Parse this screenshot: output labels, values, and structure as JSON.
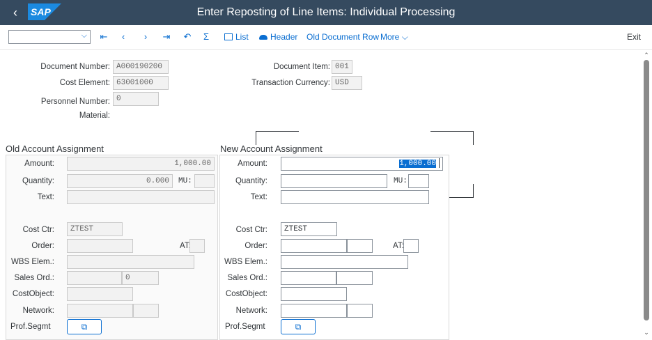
{
  "shell": {
    "back_glyph": "‹",
    "logo_text": "SAP",
    "title": "Enter Reposting of Line Items: Individual Processing"
  },
  "toolbar": {
    "select_value": "",
    "first_glyph": "⇤",
    "prev_glyph": "‹",
    "next_glyph": "›",
    "last_glyph": "⇥",
    "undo_glyph": "↶",
    "sum_glyph": "Σ",
    "list_label": "List",
    "header_label": "Header",
    "old_doc_row_label": "Old Document Row",
    "more_label": "More",
    "exit_label": "Exit"
  },
  "header": {
    "doc_number_label": "Document Number:",
    "doc_number_value": "A000190200",
    "cost_element_label": "Cost Element:",
    "cost_element_value": "63001000",
    "personnel_label": "Personnel Number:",
    "personnel_value": "0",
    "material_label": "Material:",
    "doc_item_label": "Document Item:",
    "doc_item_value": "001",
    "currency_label": "Transaction Currency:",
    "currency_value": "USD"
  },
  "old": {
    "title": "Old Account Assignment",
    "amount_label": "Amount:",
    "amount_value": "1,000.00",
    "quantity_label": "Quantity:",
    "quantity_value": "0.000",
    "mu_label": "MU:",
    "mu_value": "",
    "text_label": "Text:",
    "text_value": "",
    "costctr_label": "Cost Ctr:",
    "costctr_value": "ZTEST",
    "order_label": "Order:",
    "at_label": "AT:",
    "wbs_label": "WBS Elem.:",
    "salesord_label": "Sales Ord.:",
    "salesord_item_value": "0",
    "costobject_label": "CostObject:",
    "network_label": "Network:",
    "profsegmt_label": "Prof.Segmt",
    "profsegmt_icon": "⧉"
  },
  "new": {
    "title": "New Account Assignment",
    "amount_label": "Amount:",
    "amount_value": "1,000.00",
    "quantity_label": "Quantity:",
    "quantity_value": "",
    "mu_label": "MU:",
    "text_label": "Text:",
    "costctr_label": "Cost Ctr:",
    "costctr_value": "ZTEST",
    "order_label": "Order:",
    "at_label": "AT:",
    "wbs_label": "WBS Elem.:",
    "salesord_label": "Sales Ord.:",
    "costobject_label": "CostObject:",
    "network_label": "Network:",
    "profsegmt_label": "Prof.Segmt",
    "profsegmt_icon": "⧉"
  },
  "colors": {
    "shell_bg": "#354a5f",
    "accent": "#0a6ed1",
    "logo_bg": "#0a6ed1"
  }
}
